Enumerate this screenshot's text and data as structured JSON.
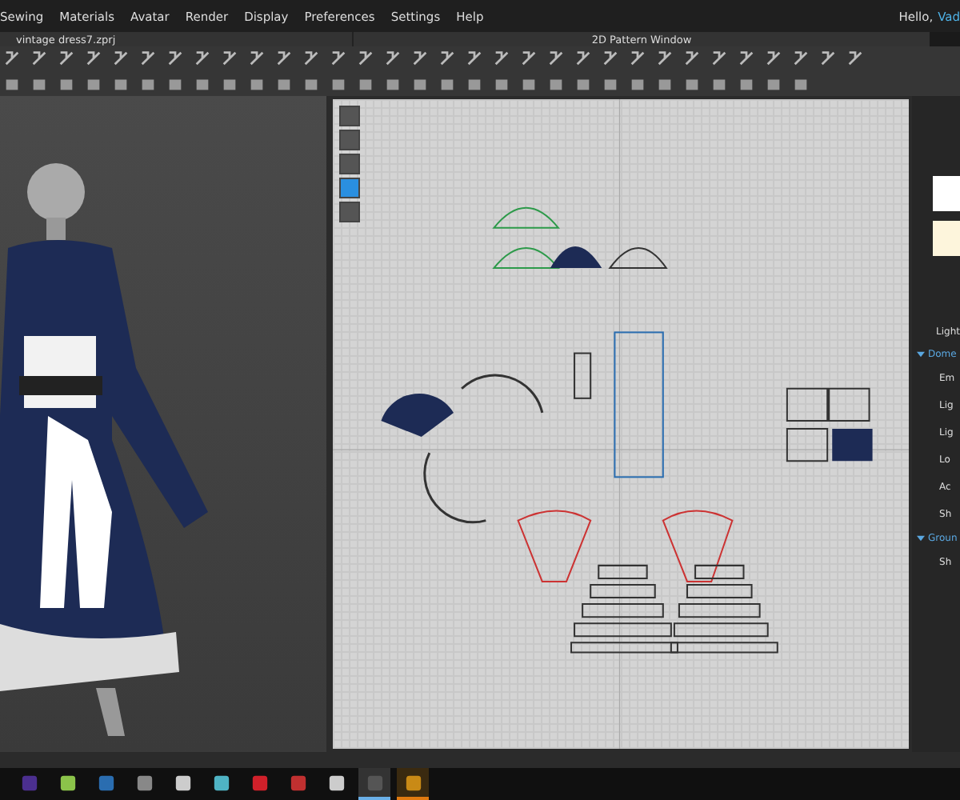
{
  "menu": {
    "items": [
      "Sewing",
      "Materials",
      "Avatar",
      "Render",
      "Display",
      "Preferences",
      "Settings",
      "Help"
    ],
    "greeting": "Hello,",
    "user": "Vad"
  },
  "view3d": {
    "title": "vintage dress7.zprj"
  },
  "view2d": {
    "title": "2D Pattern Window"
  },
  "side_tools": [
    {
      "selected": false
    },
    {
      "selected": false
    },
    {
      "selected": false
    },
    {
      "selected": true
    },
    {
      "selected": false
    }
  ],
  "properties": {
    "heading": "Light",
    "sections": [
      {
        "title": "Dome",
        "expanded": true,
        "rows": [
          "Em",
          "Lig",
          "Lig",
          "Lo",
          "Ac",
          "Sh"
        ]
      },
      {
        "title": "Groun",
        "expanded": true,
        "rows": [
          "Sh"
        ]
      }
    ]
  },
  "taskbar": [
    {
      "kind": "ae",
      "open": false
    },
    {
      "kind": "android",
      "open": false
    },
    {
      "kind": "steam",
      "open": false
    },
    {
      "kind": "tool",
      "open": false
    },
    {
      "kind": "puzzle",
      "open": false
    },
    {
      "kind": "puzzle2",
      "open": false
    },
    {
      "kind": "red",
      "open": false
    },
    {
      "kind": "disc",
      "open": false
    },
    {
      "kind": "puzzle",
      "open": false
    },
    {
      "kind": "c",
      "open": true
    },
    {
      "kind": "m",
      "open": true
    }
  ]
}
